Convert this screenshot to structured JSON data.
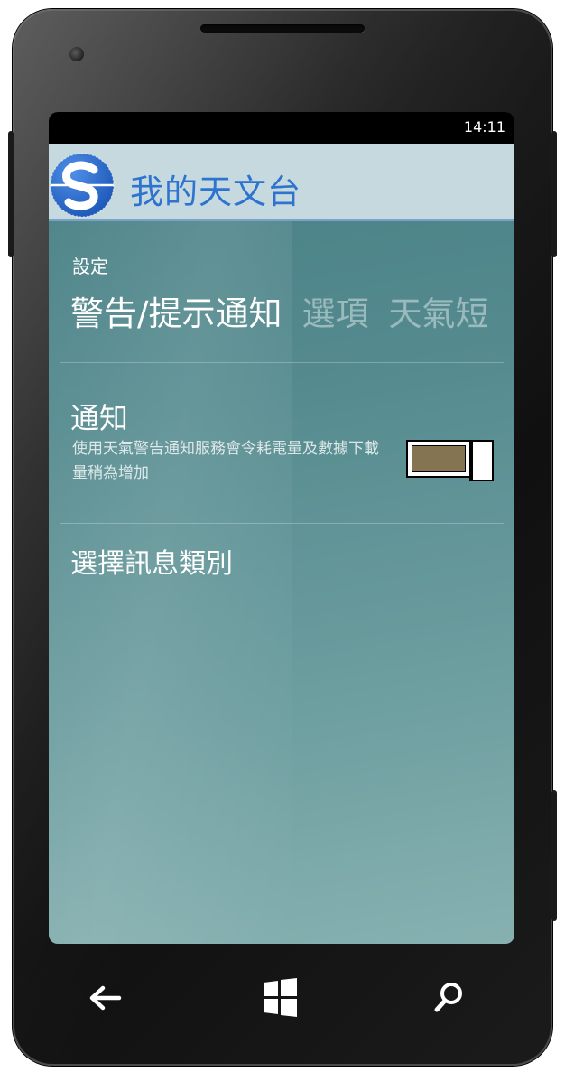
{
  "status_bar": {
    "time": "14:11"
  },
  "app_bar": {
    "title": "我的天文台",
    "logo_icon": "hko-logo-icon"
  },
  "page": {
    "overtitle": "設定",
    "pivot_tabs": [
      {
        "label": "警告/提示通知",
        "active": true
      },
      {
        "label": "選項",
        "active": false
      },
      {
        "label": "天氣短",
        "active": false
      }
    ]
  },
  "notification": {
    "title": "通知",
    "description": "使用天氣警告通知服務會令耗電量及數據下載量稍為增加",
    "toggle_on": true
  },
  "select_categories": {
    "label": "選擇訊息類別"
  },
  "nav_bar": {
    "back_icon": "back-arrow-icon",
    "start_icon": "windows-logo-icon",
    "search_icon": "search-icon"
  },
  "colors": {
    "accent": "#2e73d0",
    "app_bar_bg": "#c5d9de",
    "toggle_fill": "#847452"
  }
}
